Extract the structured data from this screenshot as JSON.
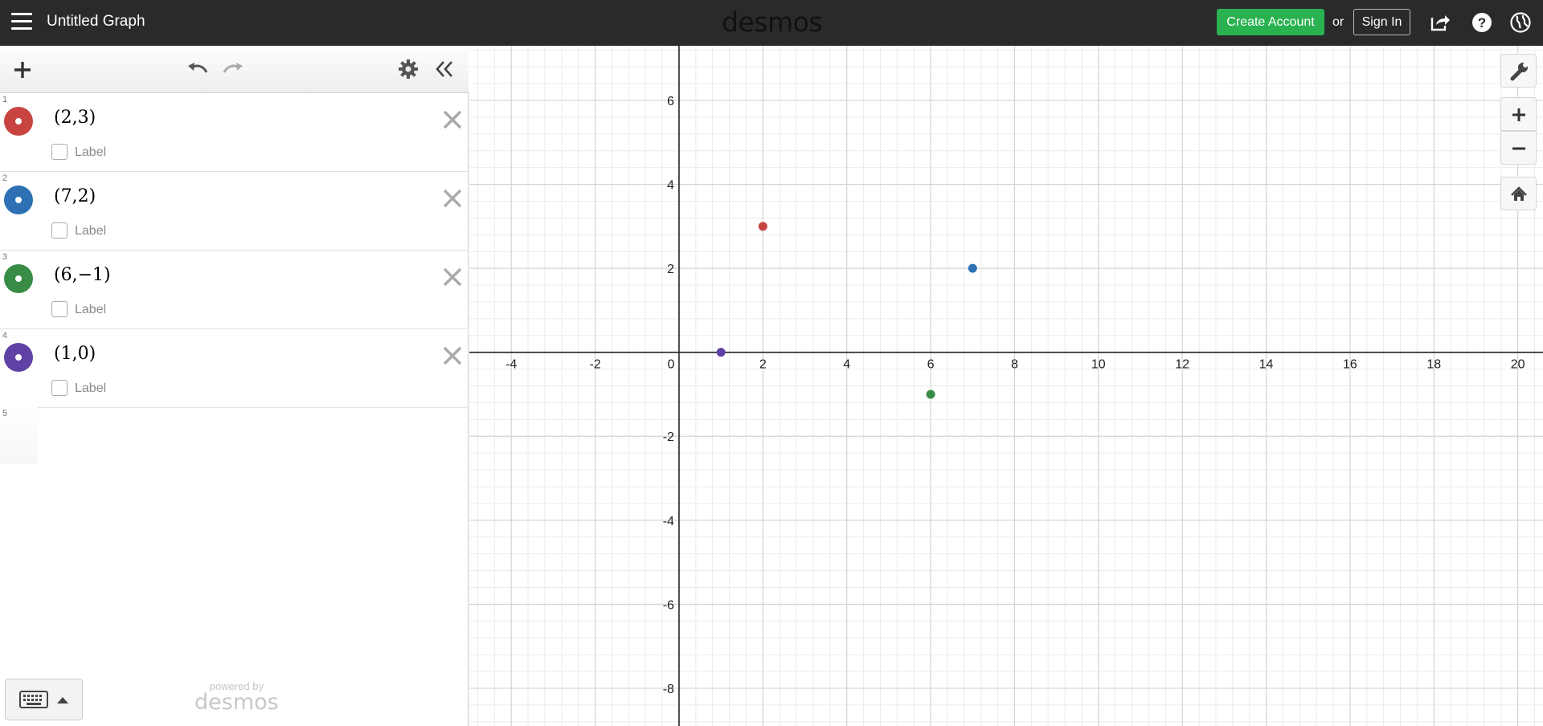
{
  "header": {
    "title": "Untitled Graph",
    "brand": "desmos",
    "create_account": "Create Account",
    "or": "or",
    "sign_in": "Sign In",
    "icons": [
      "share-icon",
      "help-icon",
      "globe-icon"
    ]
  },
  "expressions": [
    {
      "num": "1",
      "latex": "(2,3)",
      "label": "Label",
      "color": "#c74440"
    },
    {
      "num": "2",
      "latex": "(7,2)",
      "label": "Label",
      "color": "#2d70b3"
    },
    {
      "num": "3",
      "latex": "(6,−1)",
      "label": "Label",
      "color": "#388c46"
    },
    {
      "num": "4",
      "latex": "(1,0)",
      "label": "Label",
      "color": "#6042a6"
    }
  ],
  "empty_expression_num": "5",
  "powered_by": {
    "line1": "powered by",
    "line2": "desmos"
  },
  "graph": {
    "x_range": [
      -5,
      20.6
    ],
    "y_range": [
      -8.9,
      7.3
    ],
    "x_ticks": [
      -4,
      -2,
      0,
      2,
      4,
      6,
      8,
      10,
      12,
      14,
      16,
      18,
      20
    ],
    "y_ticks": [
      -8,
      -6,
      -4,
      -2,
      2,
      4,
      6
    ],
    "points": [
      {
        "x": 2,
        "y": 3,
        "color": "#c74440"
      },
      {
        "x": 7,
        "y": 2,
        "color": "#2d70b3"
      },
      {
        "x": 6,
        "y": -1,
        "color": "#388c46"
      },
      {
        "x": 1,
        "y": 0,
        "color": "#6042a6"
      }
    ]
  }
}
